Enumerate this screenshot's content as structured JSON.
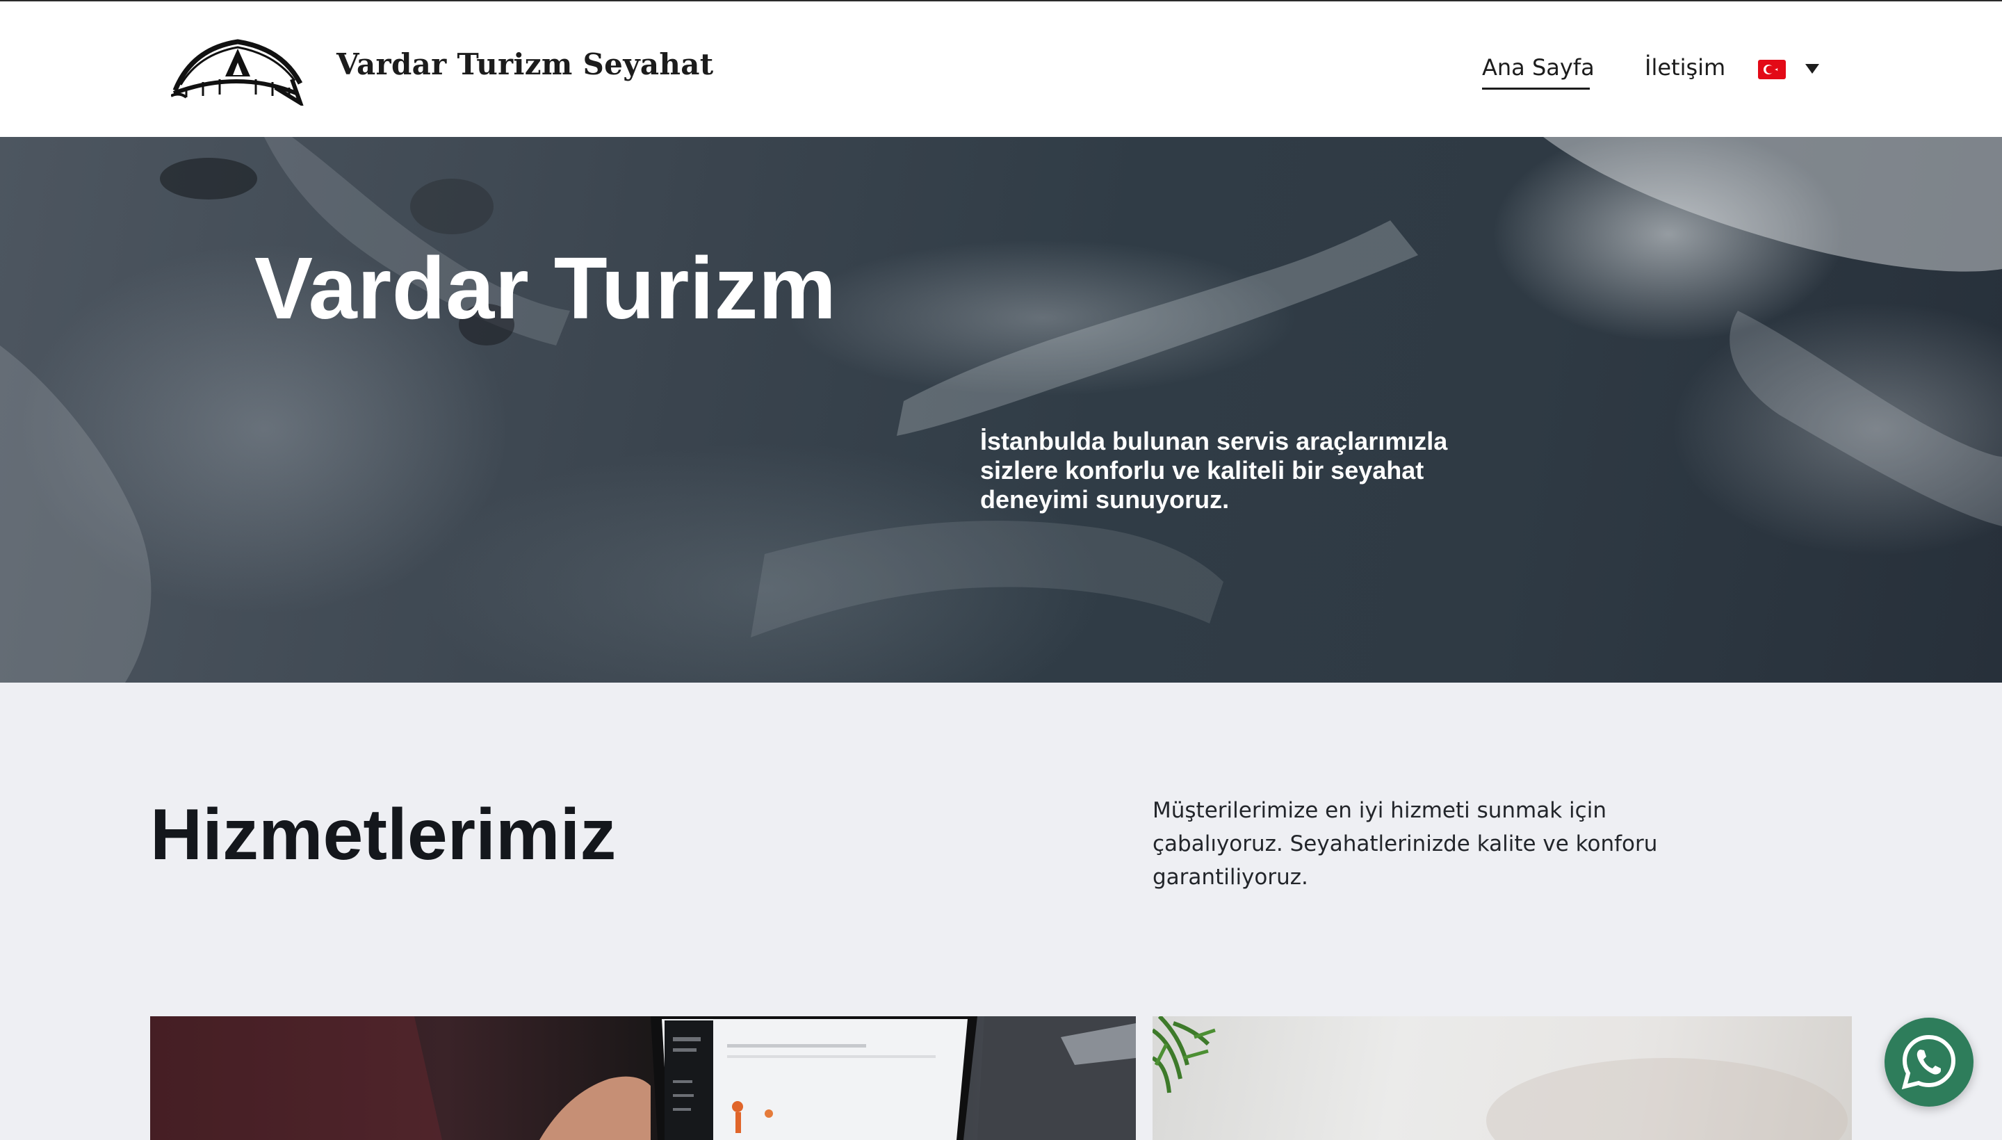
{
  "header": {
    "brand_name": "Vardar Turizm Seyahat",
    "logo_icon": "tent-logo-icon",
    "nav": [
      {
        "label": "Ana Sayfa",
        "active": true
      },
      {
        "label": "İletişim",
        "active": false
      }
    ],
    "language": {
      "flag_icon": "turkey-flag-icon",
      "dropdown_icon": "caret-down-icon"
    }
  },
  "hero": {
    "title": "Vardar Turizm",
    "description": "İstanbulda bulunan servis araçlarımızla sizlere konforlu ve kaliteli bir seyahat deneyimi sunuyoruz."
  },
  "services": {
    "title": "Hizmetlerimiz",
    "description": "Müşterilerimize en iyi hizmeti sunmak için çabalıyoruz. Seyahatlerinizde kalite ve konforu garantiliyoruz."
  },
  "floating": {
    "whatsapp_icon": "whatsapp-icon"
  },
  "colors": {
    "accent_green": "#2e7d5b",
    "flag_red": "#e30a17",
    "text_dark": "#14171c"
  }
}
